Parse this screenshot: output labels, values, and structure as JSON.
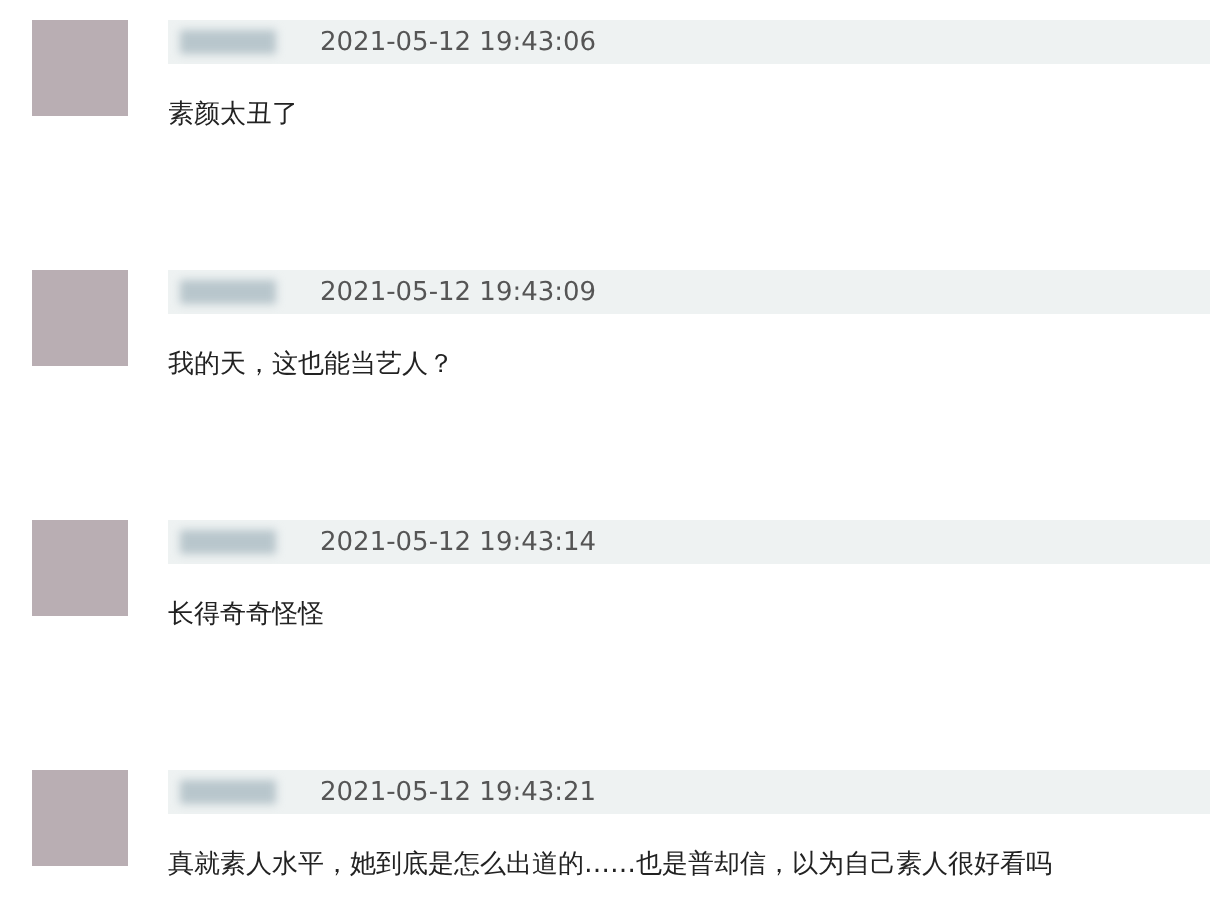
{
  "comments": [
    {
      "time": "2021-05-12 19:43:06",
      "text": "素颜太丑了"
    },
    {
      "time": "2021-05-12 19:43:09",
      "text": "我的天，这也能当艺人？"
    },
    {
      "time": "2021-05-12 19:43:14",
      "text": "长得奇奇怪怪"
    },
    {
      "time": "2021-05-12 19:43:21",
      "text": "真就素人水平，她到底是怎么出道的……也是普却信，以为自己素人很好看吗"
    }
  ]
}
